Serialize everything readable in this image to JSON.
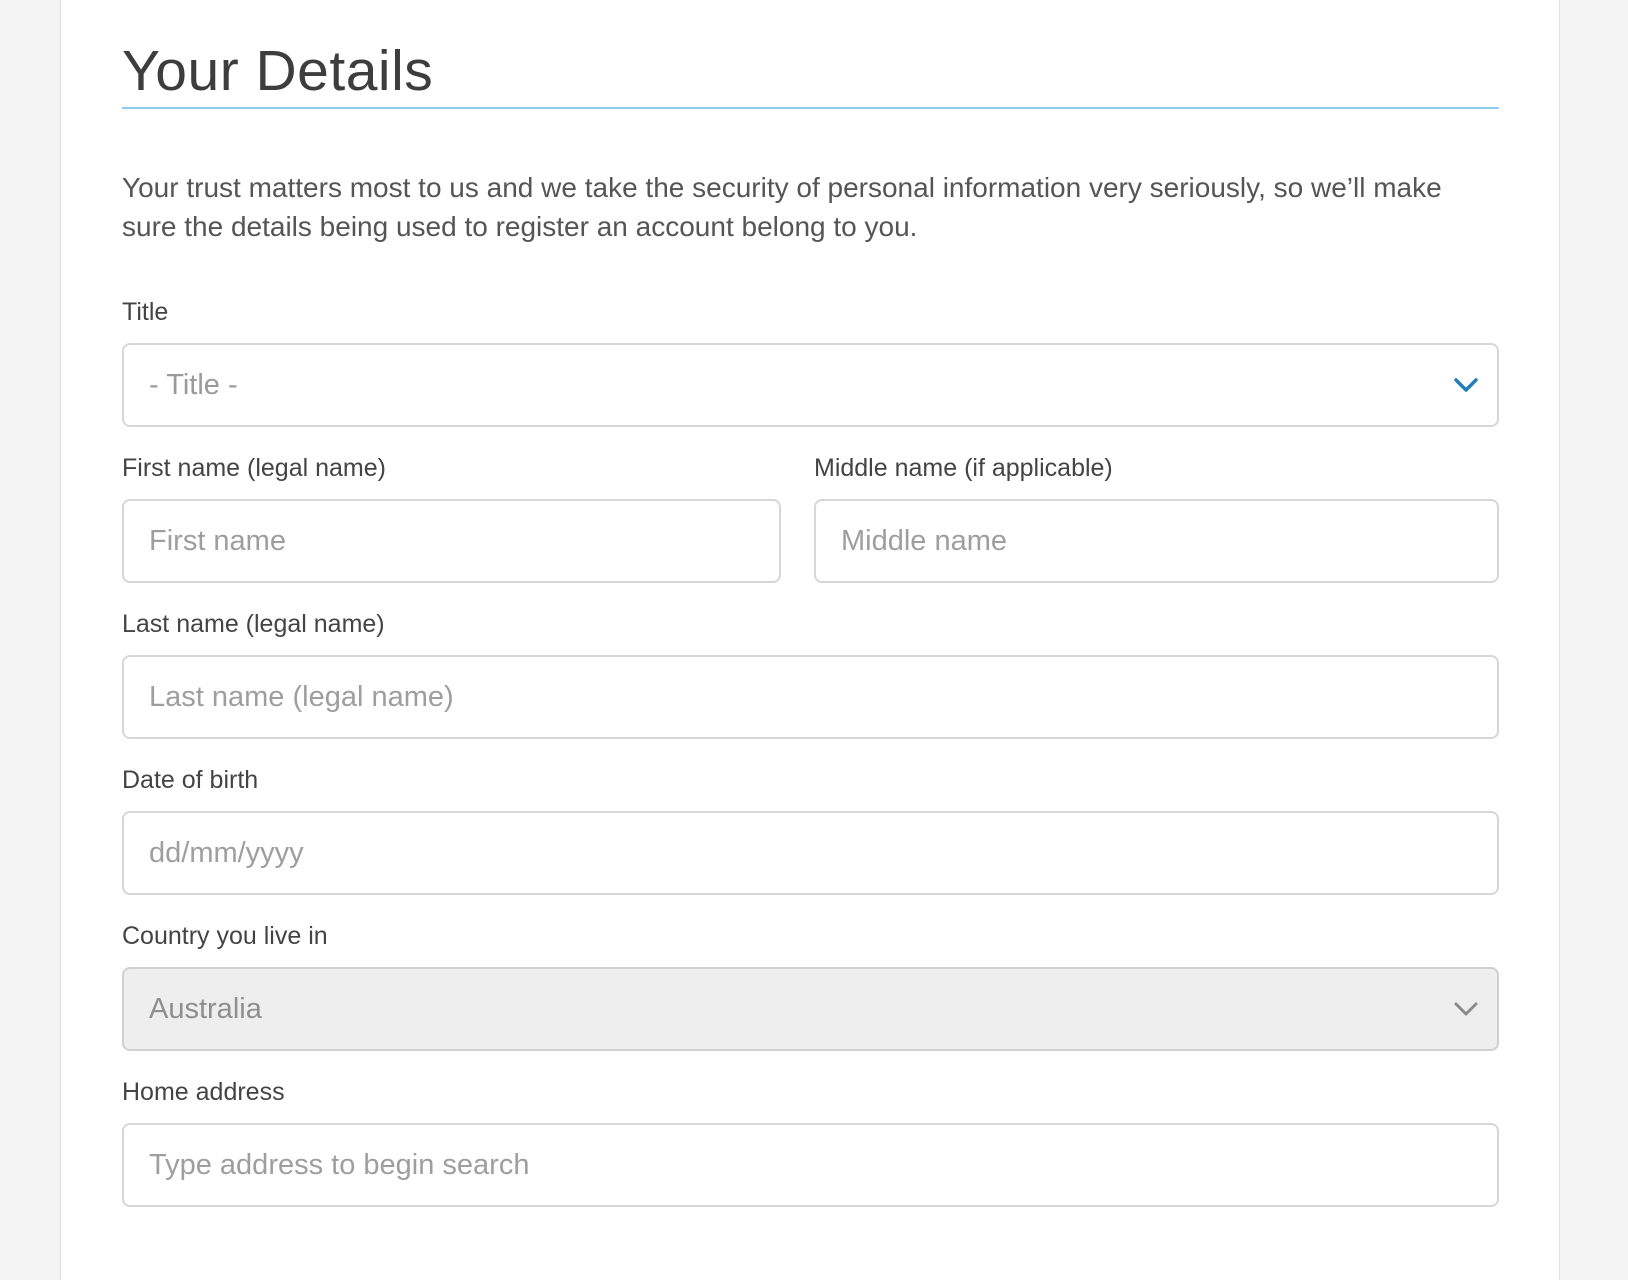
{
  "form": {
    "heading": "Your Details",
    "intro": "Your trust matters most to us and we take the security of personal information very seriously, so we’ll make sure the details being used to register an account belong to you.",
    "title_field": {
      "label": "Title",
      "placeholder": "- Title -"
    },
    "first_name": {
      "label": "First name (legal name)",
      "placeholder": "First name"
    },
    "middle_name": {
      "label": "Middle name (if applicable)",
      "placeholder": "Middle name"
    },
    "last_name": {
      "label": "Last name (legal name)",
      "placeholder": "Last name (legal name)"
    },
    "dob": {
      "label": "Date of birth",
      "placeholder": "dd/mm/yyyy"
    },
    "country": {
      "label": "Country you live in",
      "value": "Australia"
    },
    "address": {
      "label": "Home address",
      "placeholder": "Type address to begin search"
    }
  },
  "colors": {
    "accent_rule": "#8fcdec",
    "chevron_active": "#1f7fb8",
    "chevron_disabled": "#8a8a8a"
  },
  "icons": {
    "title_select": "chevron-down-icon",
    "country_select": "chevron-down-icon"
  }
}
